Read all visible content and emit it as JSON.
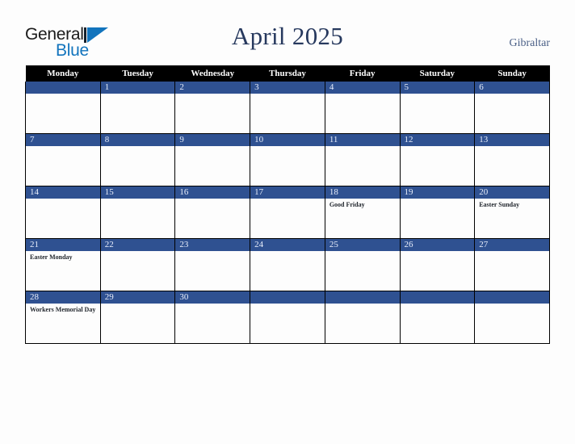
{
  "brand": {
    "name_part1": "General",
    "name_part2": "Blue",
    "mark": "triangle-logo-mark",
    "color_dark": "#1b1b1b",
    "color_blue": "#1274bd"
  },
  "header": {
    "title": "April 2025",
    "country": "Gibraltar",
    "title_color": "#27395e",
    "country_color": "#4a5f86"
  },
  "calendar": {
    "month": "April",
    "year": "2025",
    "accent_color": "#2f5191",
    "header_bg": "#000000",
    "weekday_headers": [
      "Monday",
      "Tuesday",
      "Wednesday",
      "Thursday",
      "Friday",
      "Saturday",
      "Sunday"
    ],
    "weeks": [
      [
        {
          "day": "",
          "events": []
        },
        {
          "day": "1",
          "events": []
        },
        {
          "day": "2",
          "events": []
        },
        {
          "day": "3",
          "events": []
        },
        {
          "day": "4",
          "events": []
        },
        {
          "day": "5",
          "events": []
        },
        {
          "day": "6",
          "events": []
        }
      ],
      [
        {
          "day": "7",
          "events": []
        },
        {
          "day": "8",
          "events": []
        },
        {
          "day": "9",
          "events": []
        },
        {
          "day": "10",
          "events": []
        },
        {
          "day": "11",
          "events": []
        },
        {
          "day": "12",
          "events": []
        },
        {
          "day": "13",
          "events": []
        }
      ],
      [
        {
          "day": "14",
          "events": []
        },
        {
          "day": "15",
          "events": []
        },
        {
          "day": "16",
          "events": []
        },
        {
          "day": "17",
          "events": []
        },
        {
          "day": "18",
          "events": [
            "Good Friday"
          ]
        },
        {
          "day": "19",
          "events": []
        },
        {
          "day": "20",
          "events": [
            "Easter Sunday"
          ]
        }
      ],
      [
        {
          "day": "21",
          "events": [
            "Easter Monday"
          ]
        },
        {
          "day": "22",
          "events": []
        },
        {
          "day": "23",
          "events": []
        },
        {
          "day": "24",
          "events": []
        },
        {
          "day": "25",
          "events": []
        },
        {
          "day": "26",
          "events": []
        },
        {
          "day": "27",
          "events": []
        }
      ],
      [
        {
          "day": "28",
          "events": [
            "Workers Memorial Day"
          ]
        },
        {
          "day": "29",
          "events": []
        },
        {
          "day": "30",
          "events": []
        },
        {
          "day": "",
          "events": []
        },
        {
          "day": "",
          "events": []
        },
        {
          "day": "",
          "events": []
        },
        {
          "day": "",
          "events": []
        }
      ]
    ]
  }
}
